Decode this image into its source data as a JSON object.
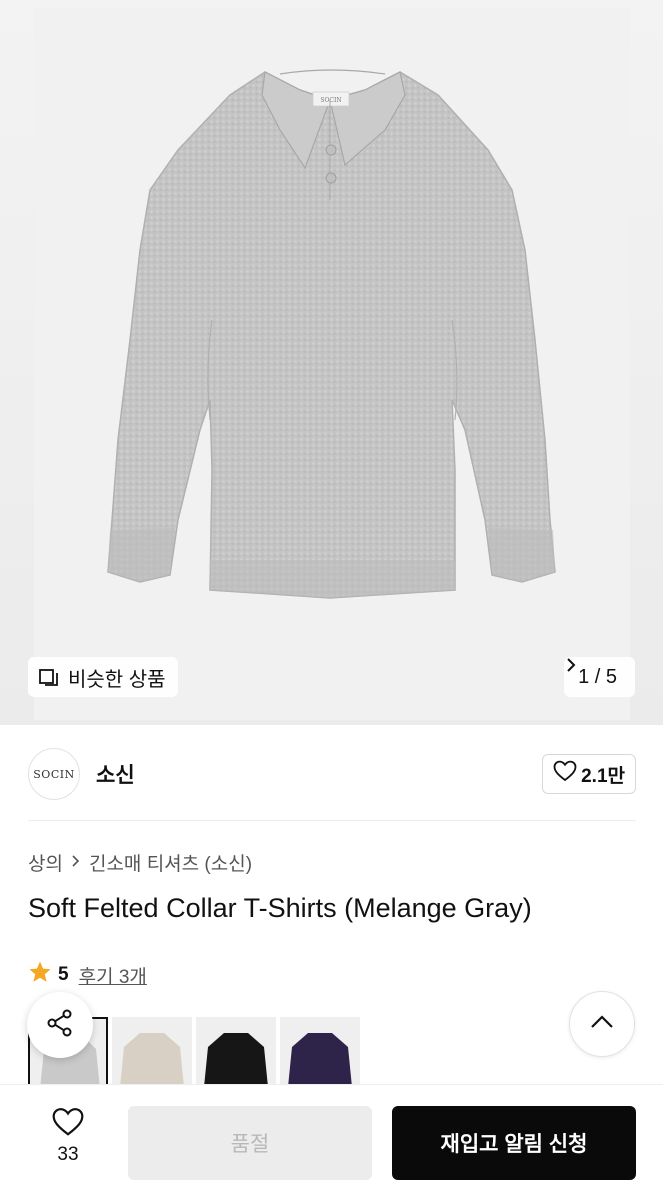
{
  "hero": {
    "similar_label": "비슷한 상품",
    "pager_text": "1 / 5",
    "tag_text": "SOCIN"
  },
  "brand": {
    "logo_text": "SOCIN",
    "name": "소신",
    "like_count": "2.1만"
  },
  "breadcrumb": {
    "level1": "상의",
    "level2": "긴소매 티셔츠 (소신)"
  },
  "product": {
    "title": "Soft Felted Collar T-Shirts (Melange Gray)"
  },
  "rating": {
    "score": "5",
    "reviews_link": "후기 3개"
  },
  "swatches": [
    {
      "name": "Melange Gray",
      "color": "#c9c9c9",
      "selected": true
    },
    {
      "name": "Beige",
      "color": "#d8d0c4"
    },
    {
      "name": "Black",
      "color": "#161616"
    },
    {
      "name": "Purple",
      "color": "#2e2348"
    }
  ],
  "bottom_bar": {
    "wish_count": "33",
    "soldout_label": "품절",
    "notify_label": "재입고 알림 신청"
  },
  "colors": {
    "accent_star": "#f5a623",
    "primary_button": "#0a0a0a",
    "disabled_button": "#ececec"
  },
  "icons": {
    "similar": "similar-products-icon",
    "pager": "chevron-right-icon",
    "like": "heart-outline-icon",
    "breadcrumb_sep": "chevron-right-icon",
    "star": "star-icon",
    "share": "share-icon",
    "top": "chevron-up-icon",
    "wish": "heart-outline-icon"
  }
}
